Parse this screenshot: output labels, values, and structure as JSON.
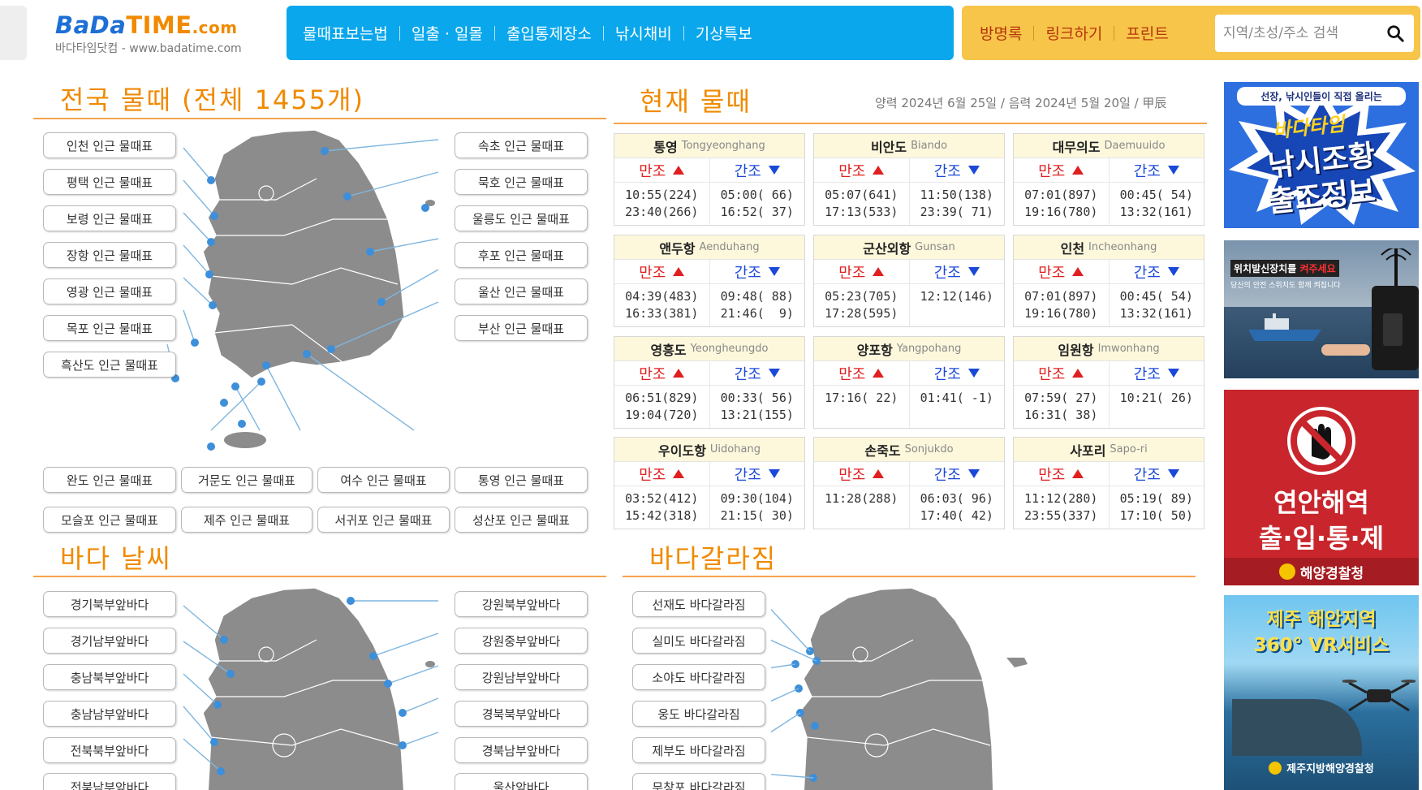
{
  "header": {
    "logo_main": "BaDa",
    "logo_time": "TIME",
    "logo_com": ".com",
    "logo_sub": "바다타임닷컴 - www.badatime.com",
    "nav_blue": [
      "물때표보는법",
      "일출 · 일몰",
      "출입통제장소",
      "낚시채비",
      "기상특보"
    ],
    "nav_yellow": [
      "방명록",
      "링크하기",
      "프린트"
    ],
    "search_placeholder": "지역/초성/주소 검색"
  },
  "sections": {
    "tide_all_title": "전국  물때 (전체  1455개)",
    "tide_now_title": "현재  물때",
    "date_text": "양력  2024년  6월  25일  /  음력  2024년  5월  20일  /  甲辰",
    "weather_title": "바다  날씨",
    "sea_split_title": "바다갈라짐"
  },
  "tide_regions_left": [
    "인천 인근 물때표",
    "평택 인근 물때표",
    "보령 인근 물때표",
    "장항 인근 물때표",
    "영광 인근 물때표",
    "목포 인근 물때표",
    "흑산도 인근 물때표"
  ],
  "tide_regions_right": [
    "속초 인근 물때표",
    "묵호 인근 물때표",
    "울릉도 인근 물때표",
    "후포 인근 물때표",
    "울산 인근 물때표",
    "부산 인근 물때표"
  ],
  "tide_regions_bottom1": [
    "완도 인근 물때표",
    "거문도 인근 물때표",
    "여수 인근 물때표",
    "통영 인근 물때표"
  ],
  "tide_regions_bottom2": [
    "모슬포 인근 물때표",
    "제주 인근 물때표",
    "서귀포 인근 물때표",
    "성산포 인근 물때표"
  ],
  "tide_labels": {
    "high": "만조",
    "low": "간조"
  },
  "tides": [
    {
      "name": "통영",
      "en": "Tongyeonghang",
      "high": "10:55(224)\n23:40(266)",
      "low": "05:00( 66)\n16:52( 37)"
    },
    {
      "name": "비안도",
      "en": "Biando",
      "high": "05:07(641)\n17:13(533)",
      "low": "11:50(138)\n23:39( 71)"
    },
    {
      "name": "대무의도",
      "en": "Daemuuido",
      "high": "07:01(897)\n19:16(780)",
      "low": "00:45( 54)\n13:32(161)"
    },
    {
      "name": "앤두항",
      "en": "Aenduhang",
      "high": "04:39(483)\n16:33(381)",
      "low": "09:48( 88)\n21:46(  9)"
    },
    {
      "name": "군산외항",
      "en": "Gunsan",
      "high": "05:23(705)\n17:28(595)",
      "low": "12:12(146)"
    },
    {
      "name": "인천",
      "en": "Incheonhang",
      "high": "07:01(897)\n19:16(780)",
      "low": "00:45( 54)\n13:32(161)"
    },
    {
      "name": "영흥도",
      "en": "Yeongheungdo",
      "high": "06:51(829)\n19:04(720)",
      "low": "00:33( 56)\n13:21(155)"
    },
    {
      "name": "양포항",
      "en": "Yangpohang",
      "high": "17:16( 22)",
      "low": "01:41( -1)"
    },
    {
      "name": "임원항",
      "en": "Imwonhang",
      "high": "07:59( 27)\n16:31( 38)",
      "low": "10:21( 26)"
    },
    {
      "name": "우이도항",
      "en": "Uidohang",
      "high": "03:52(412)\n15:42(318)",
      "low": "09:30(104)\n21:15( 30)"
    },
    {
      "name": "손죽도",
      "en": "Sonjukdo",
      "high": "11:28(288)",
      "low": "06:03( 96)\n17:40( 42)"
    },
    {
      "name": "사포리",
      "en": "Sapo-ri",
      "high": "11:12(280)\n23:55(337)",
      "low": "05:19( 89)\n17:10( 50)"
    }
  ],
  "weather_left": [
    "경기북부앞바다",
    "경기남부앞바다",
    "충남북부앞바다",
    "충남남부앞바다",
    "전북북부앞바다",
    "전북남부앞바다"
  ],
  "weather_right": [
    "강원북부앞바다",
    "강원중부앞바다",
    "강원남부앞바다",
    "경북북부앞바다",
    "경북남부앞바다",
    "울산앞바다"
  ],
  "split_list": [
    "선재도 바다갈라짐",
    "실미도 바다갈라짐",
    "소야도 바다갈라짐",
    "웅도 바다갈라짐",
    "제부도 바다갈라짐",
    "무창포 바다갈라짐"
  ],
  "ads": {
    "ad1_top": "선장, 낚시인들이 직접 올리는",
    "ad1_logo": "바다타임",
    "ad1_main1": "낚시조황",
    "ad1_main2": "출조정보",
    "ad2_top1": "위치발신장치를",
    "ad2_top2": "켜주세요",
    "ad2_sub": "당신의 안전 스위치도 함께 켜집니다",
    "ad3_main1": "연안해역",
    "ad3_main2": "출·입·통·제",
    "ad3_org": "해양경찰청",
    "ad4_main1": "제주 해안지역",
    "ad4_main2": "360° VR서비스",
    "ad4_org": "제주지방해양경찰청"
  },
  "colors": {
    "accent_orange": "#f08a00",
    "nav_blue": "#0aa7ec",
    "nav_yellow": "#f7c54a",
    "high_red": "#e02020",
    "low_blue": "#1a48d8"
  }
}
